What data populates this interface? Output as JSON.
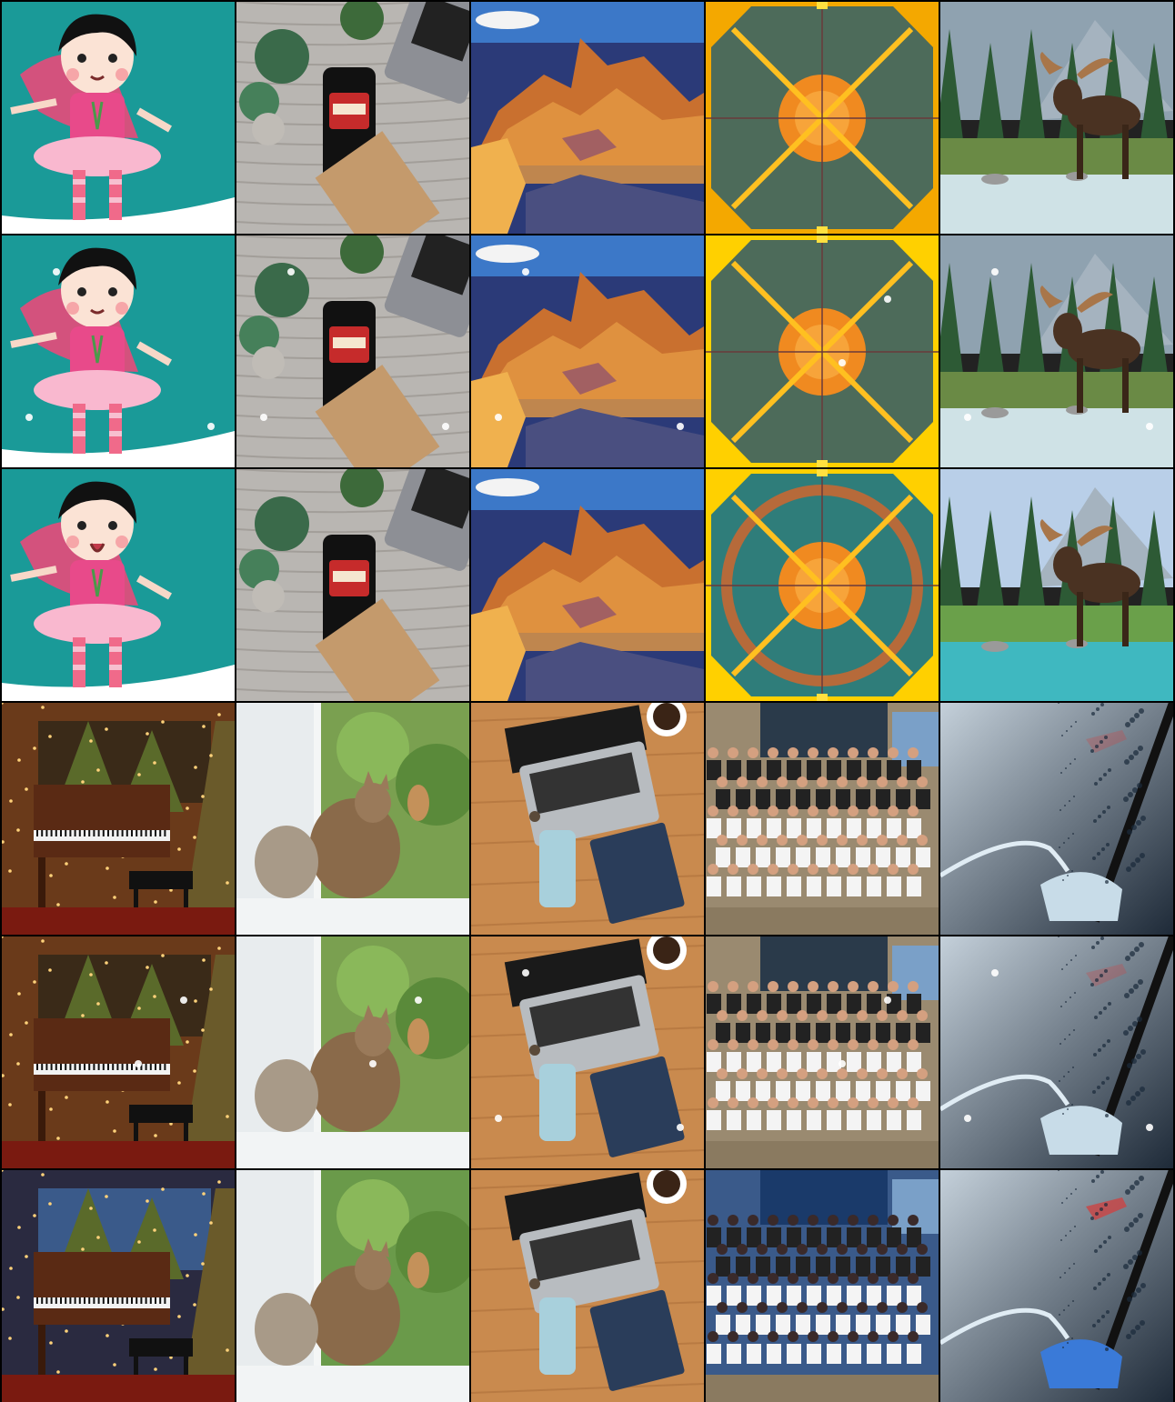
{
  "grid": {
    "columns": 5,
    "rows": 6,
    "border_color": "#000000",
    "variants_per_subject": [
      "top-realistic",
      "middle-artifacts",
      "bottom-stylized"
    ]
  },
  "tiles": [
    {
      "subject": "cartoon-girl-pink-tutu",
      "row": 0,
      "col": 0
    },
    {
      "subject": "phone-case-on-desk",
      "row": 0,
      "col": 1
    },
    {
      "subject": "grand-canyon",
      "row": 0,
      "col": 2
    },
    {
      "subject": "orange-target-pattern",
      "row": 0,
      "col": 3
    },
    {
      "subject": "moose-in-river",
      "row": 0,
      "col": 4
    },
    {
      "subject": "cartoon-girl-pink-tutu",
      "row": 1,
      "col": 0
    },
    {
      "subject": "phone-case-on-desk",
      "row": 1,
      "col": 1
    },
    {
      "subject": "grand-canyon",
      "row": 1,
      "col": 2
    },
    {
      "subject": "orange-target-pattern",
      "row": 1,
      "col": 3
    },
    {
      "subject": "moose-in-river",
      "row": 1,
      "col": 4
    },
    {
      "subject": "cartoon-girl-pink-tutu",
      "row": 2,
      "col": 0
    },
    {
      "subject": "phone-case-on-desk",
      "row": 2,
      "col": 1
    },
    {
      "subject": "grand-canyon",
      "row": 2,
      "col": 2
    },
    {
      "subject": "orange-target-pattern",
      "row": 2,
      "col": 3
    },
    {
      "subject": "moose-in-river",
      "row": 2,
      "col": 4
    },
    {
      "subject": "christmas-piano",
      "row": 3,
      "col": 0
    },
    {
      "subject": "cat-at-window",
      "row": 3,
      "col": 1
    },
    {
      "subject": "laptop-on-desk",
      "row": 3,
      "col": 2
    },
    {
      "subject": "group-photo",
      "row": 3,
      "col": 3
    },
    {
      "subject": "water-splash",
      "row": 3,
      "col": 4
    },
    {
      "subject": "christmas-piano",
      "row": 4,
      "col": 0
    },
    {
      "subject": "cat-at-window",
      "row": 4,
      "col": 1
    },
    {
      "subject": "laptop-on-desk",
      "row": 4,
      "col": 2
    },
    {
      "subject": "group-photo",
      "row": 4,
      "col": 3
    },
    {
      "subject": "water-splash",
      "row": 4,
      "col": 4
    },
    {
      "subject": "christmas-piano",
      "row": 5,
      "col": 0
    },
    {
      "subject": "cat-at-window",
      "row": 5,
      "col": 1
    },
    {
      "subject": "laptop-on-desk",
      "row": 5,
      "col": 2
    },
    {
      "subject": "group-photo",
      "row": 5,
      "col": 3
    },
    {
      "subject": "water-splash",
      "row": 5,
      "col": 4
    }
  ]
}
